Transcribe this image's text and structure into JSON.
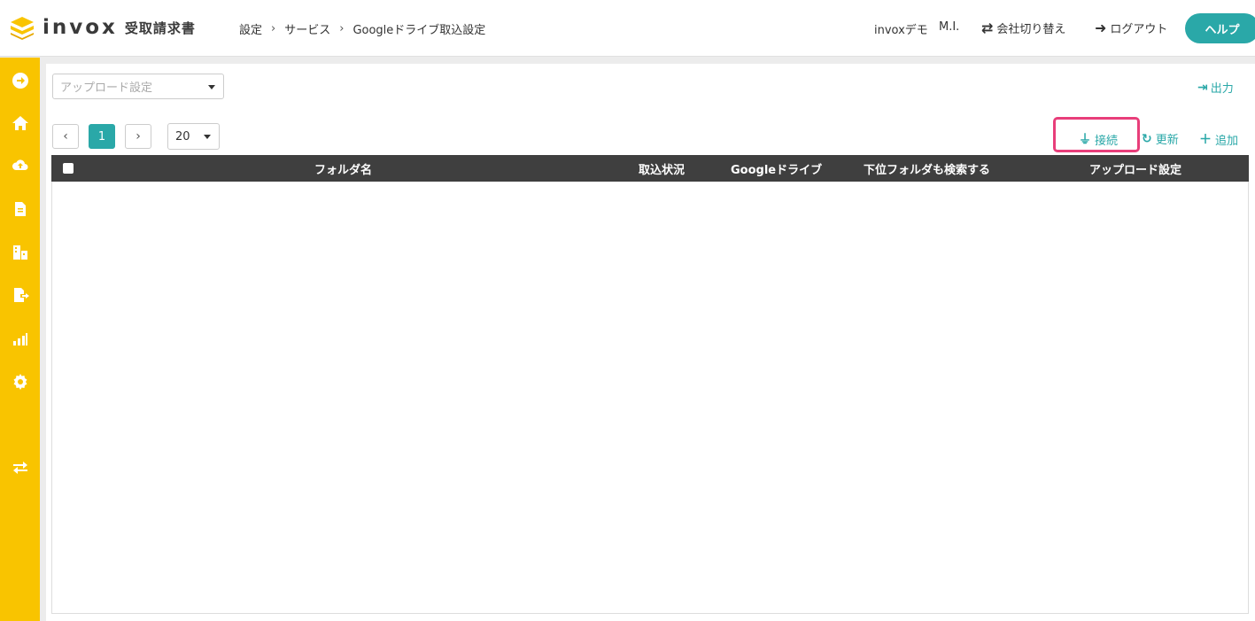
{
  "header": {
    "logo_text": "invox",
    "logo_sub": "受取請求書",
    "breadcrumb": [
      "設定",
      "サービス",
      "Googleドライブ取込設定"
    ],
    "company": "invoxデモ",
    "user": "M.I.",
    "switch_company": "会社切り替え",
    "logout": "ログアウト",
    "help": "ヘルプ"
  },
  "colors": {
    "accent": "#2aa8a8",
    "sidebar": "#f9c400",
    "highlight": "#e83e7a",
    "table_header": "#3f3f3f"
  },
  "sidebar": {
    "items": [
      {
        "icon": "arrow-right-circle-icon"
      },
      {
        "icon": "home-icon"
      },
      {
        "icon": "cloud-upload-icon"
      },
      {
        "icon": "document-icon"
      },
      {
        "icon": "building-icon"
      },
      {
        "icon": "file-export-icon"
      },
      {
        "icon": "chart-icon"
      },
      {
        "icon": "gear-icon"
      },
      {
        "icon": "switch-arrows-icon"
      }
    ]
  },
  "filter": {
    "upload_setting_placeholder": "アップロード設定"
  },
  "actions": {
    "export": "出力",
    "connect": "接続",
    "refresh": "更新",
    "add": "追加"
  },
  "pager": {
    "prev": "‹",
    "current": "1",
    "next": "›",
    "per_page": "20"
  },
  "table": {
    "columns": [
      "フォルダ名",
      "取込状況",
      "Googleドライブ",
      "下位フォルダも検索する",
      "アップロード設定"
    ],
    "rows": []
  }
}
